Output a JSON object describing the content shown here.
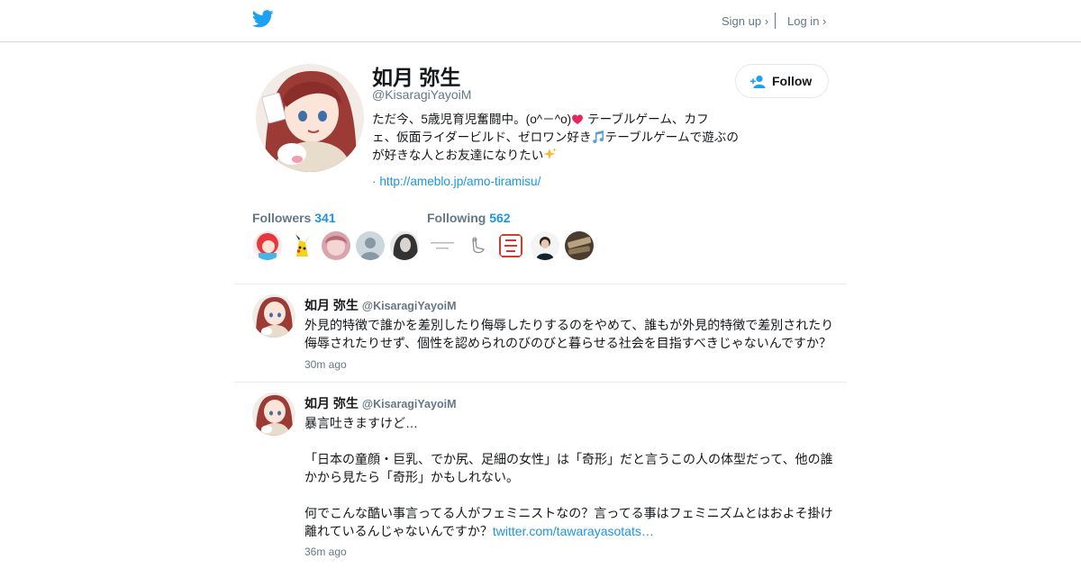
{
  "nav": {
    "logo_icon": "twitter-bird-icon",
    "signup_label": "Sign up ›",
    "login_label": "Log in ›"
  },
  "colors": {
    "brand": "#1da1f2",
    "link": "#1b95e0",
    "secondary_text": "#657786",
    "border": "#e6ecf0"
  },
  "profile": {
    "name": "如月 弥生",
    "handle": "@KisaragiYayoiM",
    "follow_label": "Follow",
    "follow_icon": "add-user-icon",
    "bio_lines": [
      "ただ今、5歳児育児奮闘中。(o^－^o)",
      " テーブルゲーム、カフ",
      "ェ、仮面ライダービルド、ゼロワン好き",
      "テーブルゲームで遊ぶの",
      "が好きな人とお友達になりたい"
    ],
    "url_prefix": "·",
    "url": "http://ameblo.jp/amo-tiramisu/"
  },
  "stats": {
    "followers_label": "Followers",
    "followers_count": "341",
    "following_label": "Following",
    "following_count": "562"
  },
  "tweets": [
    {
      "name": "如月 弥生",
      "handle": "@KisaragiYayoiM",
      "lines": [
        "外見的特徴で誰かを差別したり侮辱したりするのをやめて、誰もが外見的特徴で差別されたり",
        "侮辱されたりせず、個性を認められのびのびと暮らせる社会を目指すべきじゃないんですか？"
      ],
      "time": "30m ago"
    },
    {
      "name": "如月 弥生",
      "handle": "@KisaragiYayoiM",
      "lines": [
        "暴言吐きますけど…",
        "",
        "「日本の童顔・巨乳、でか尻、足細の女性」は「奇形」だと言うこの人の体型だって、他の誰",
        "かから見たら「奇形」かもしれない。",
        "",
        "何でこんな酷い事言ってる人がフェミニストなの？言ってる事はフェミニズムとはおよそ掛け",
        "離れているんじゃないんですか？"
      ],
      "link": "twitter.com/tawarayasotats…",
      "time": "36m ago"
    }
  ]
}
